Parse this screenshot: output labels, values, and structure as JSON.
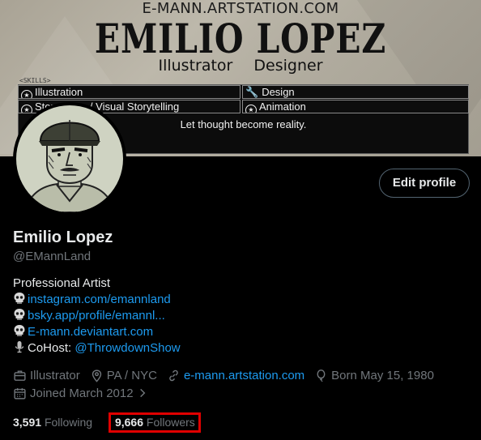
{
  "banner": {
    "site": "E-MANN.ARTSTATION.COM",
    "name": "EMILIO LOPEZ",
    "role1": "Illustrator",
    "role2": "Designer",
    "skills_tag": "<SKILLS>",
    "skills": [
      {
        "icon": "star-icon",
        "label": "Illustration"
      },
      {
        "icon": "wrench-icon",
        "label": "Design"
      },
      {
        "icon": "star-icon",
        "label": "Storytelling / Visual Storytelling"
      },
      {
        "icon": "star-icon",
        "label": "Animation"
      }
    ],
    "tagline": "Let thought become reality."
  },
  "edit_profile": "Edit profile",
  "profile": {
    "display_name": "Emilio Lopez",
    "handle": "@EMannLand",
    "bio": {
      "title": "Professional Artist",
      "links": [
        {
          "icon": "skull-icon",
          "text": "instagram.com/emannland"
        },
        {
          "icon": "skull-icon",
          "text": "bsky.app/profile/emannl..."
        },
        {
          "icon": "skull-icon",
          "text": "E-mann.deviantart.com"
        }
      ],
      "cohost_prefix": "CoHost: ",
      "cohost_handle": "@ThrowdownShow"
    },
    "meta": {
      "category": "Illustrator",
      "location": "PA / NYC",
      "website": "e-mann.artstation.com",
      "birthday": "Born May 15, 1980",
      "joined": "Joined March 2012"
    },
    "following_count": "3,591",
    "following_label": "Following",
    "followers_count": "9,666",
    "followers_label": "Followers"
  },
  "colors": {
    "link": "#1d9bf0",
    "muted": "#71767b",
    "highlight": "#e00000"
  }
}
